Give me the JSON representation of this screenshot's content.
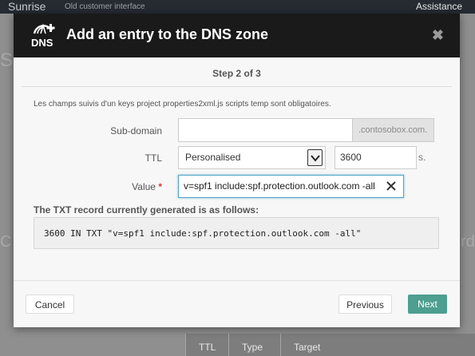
{
  "background": {
    "brand": "Sunrise",
    "old_interface": "Old customer interface",
    "assistance": "Assistance",
    "table_headers": [
      "TTL",
      "Type",
      "Target"
    ]
  },
  "modal": {
    "title": "Add an entry to the DNS zone",
    "logo_text": "DNS",
    "close_glyph": "✖",
    "step": "Step 2 of 3",
    "required_note": "Les champs suivis d'un keys project properties2xml.js scripts temp sont obligatoires.",
    "fields": {
      "subdomain": {
        "label": "Sub-domain",
        "value": "",
        "suffix": ".contosobox.com."
      },
      "ttl": {
        "label": "TTL",
        "selected": "Personalised",
        "value": "3600",
        "unit": "s."
      },
      "value": {
        "label": "Value",
        "required_mark": "*",
        "value": "v=spf1 include:spf.protection.outlook.com -all"
      }
    },
    "txt_record": {
      "heading": "The TXT record currently generated is as follows:",
      "content": "3600 IN TXT \"v=spf1 include:spf.protection.outlook.com -all\""
    },
    "buttons": {
      "cancel": "Cancel",
      "previous": "Previous",
      "next": "Next"
    }
  },
  "colors": {
    "header_bg": "#1a1a1a",
    "next_button": "#4d9f8f",
    "required_star": "#d9372c",
    "focus_border": "#4fa3c7"
  }
}
